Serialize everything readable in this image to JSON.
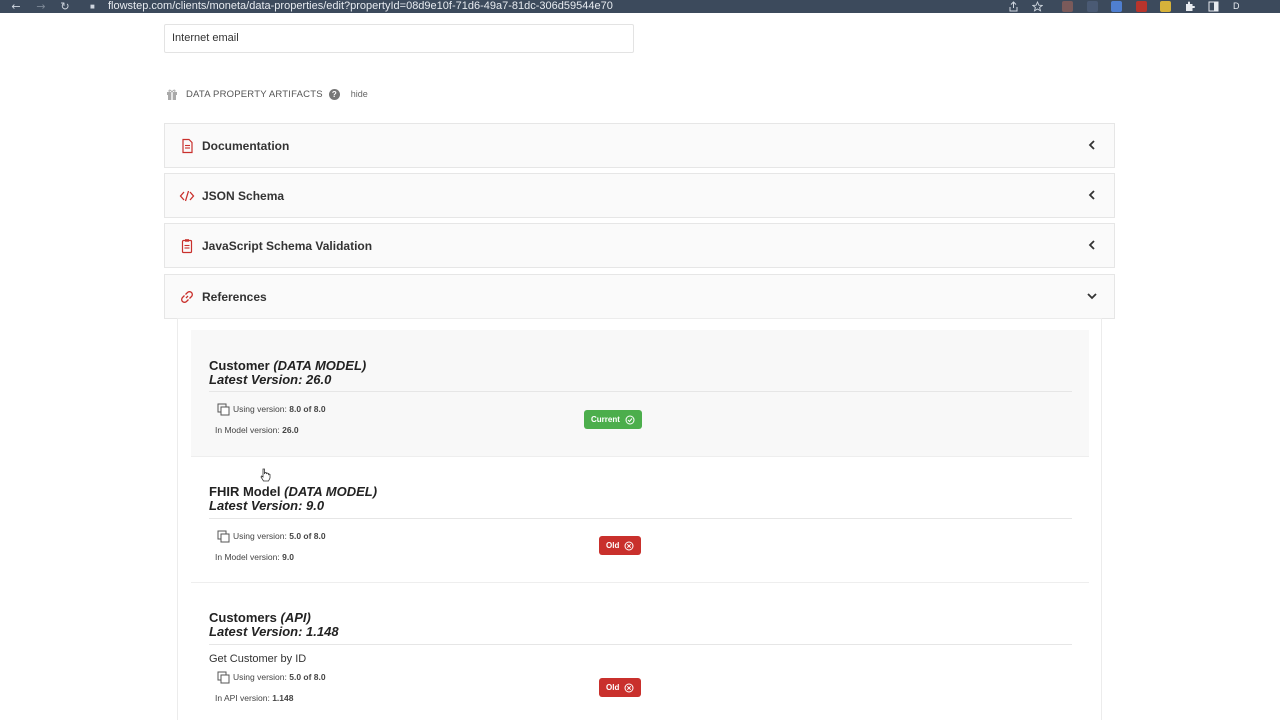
{
  "browser": {
    "url": "flowstep.com/clients/moneta/data-properties/edit?propertyId=08d9e10f-71d6-49a7-81dc-306d59544e70",
    "profile_initial": "D",
    "bar_color": "#3c4a5c"
  },
  "email_field": {
    "value": "Internet email"
  },
  "artifacts": {
    "title": "DATA PROPERTY ARTIFACTS",
    "help_icon": "question-circle-icon",
    "hide_label": "hide"
  },
  "panels": [
    {
      "title": "Documentation",
      "icon": "document-icon",
      "expanded": false
    },
    {
      "title": "JSON Schema",
      "icon": "code-icon",
      "expanded": false
    },
    {
      "title": "JavaScript Schema Validation",
      "icon": "clipboard-icon",
      "expanded": false
    },
    {
      "title": "References",
      "icon": "link-icon",
      "expanded": true
    }
  ],
  "references": [
    {
      "name": "Customer",
      "type": "(DATA MODEL)",
      "latest_label": "Latest Version: 26.0",
      "using_prefix": "Using version:",
      "using_value": "8.0 of 8.0",
      "model_prefix": "In Model version:",
      "model_value": "26.0",
      "status": "Current",
      "status_color": "#4cae4c"
    },
    {
      "name": "FHIR Model",
      "type": "(DATA MODEL)",
      "latest_label": "Latest Version: 9.0",
      "using_prefix": "Using version:",
      "using_value": "5.0 of 8.0",
      "model_prefix": "In Model version:",
      "model_value": "9.0",
      "status": "Old",
      "status_color": "#c9302c"
    },
    {
      "name": "Customers",
      "type": "(API)",
      "latest_label": "Latest Version: 1.148",
      "subtitle": "Get Customer by ID",
      "using_prefix": "Using version:",
      "using_value": "5.0 of 8.0",
      "model_prefix": "In API version:",
      "model_value": "1.148",
      "status": "Old",
      "status_color": "#c9302c"
    }
  ]
}
